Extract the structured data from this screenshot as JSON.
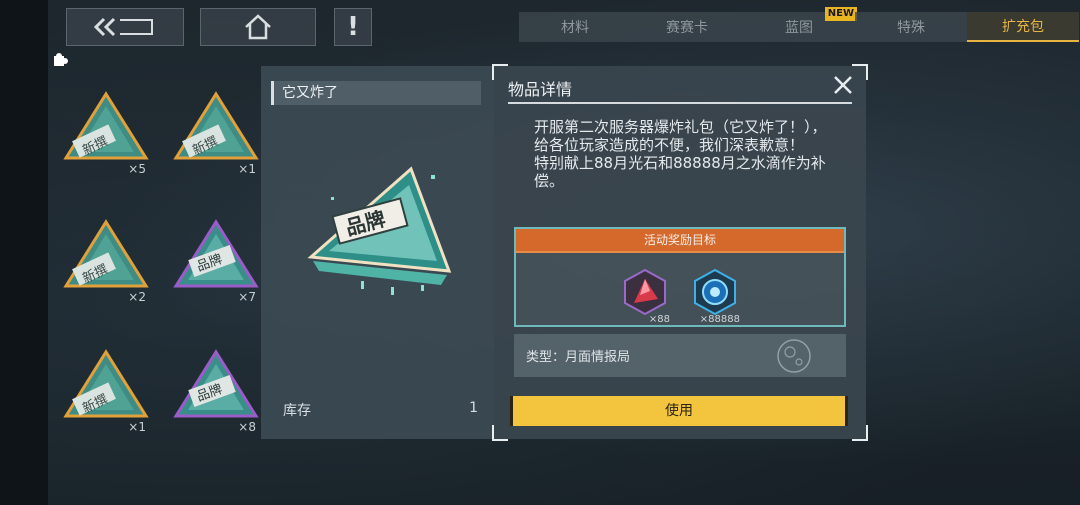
{
  "topbar": {
    "back_label": "back",
    "home_label": "home",
    "alert_label": "!"
  },
  "tabs": [
    {
      "label": "材料"
    },
    {
      "label": "赛赛卡"
    },
    {
      "label": "蓝图",
      "badge": "NEW"
    },
    {
      "label": "特殊"
    },
    {
      "label": "扩充包",
      "active": true
    }
  ],
  "inventory": [
    {
      "type": "new-pack",
      "label": "新撰",
      "count": "×5"
    },
    {
      "type": "new-pack",
      "label": "新撰",
      "count": "×1"
    },
    {
      "type": "new-pack",
      "label": "新撰",
      "count": "×2"
    },
    {
      "type": "brand-pack",
      "label": "品牌",
      "count": "×7"
    },
    {
      "type": "new-pack",
      "label": "新撰",
      "count": "×1"
    },
    {
      "type": "brand-pack",
      "label": "品牌",
      "count": "×8"
    }
  ],
  "item_info": {
    "name": "它又炸了",
    "icon_label": "品牌",
    "stock_label": "库存",
    "stock_value": "1"
  },
  "detail": {
    "title": "物品详情",
    "description": "开服第二次服务器爆炸礼包（它又炸了！），给各位玩家造成的不便，我们深表歉意！\n特别献上88月光石和88888月之水滴作为补偿。",
    "reward_header": "活动奖励目标",
    "rewards": [
      {
        "name": "moonstone-icon",
        "qty": "×88"
      },
      {
        "name": "moon-water-icon",
        "qty": "×88888"
      }
    ],
    "type_text": "类型：月面情报局",
    "use_label": "使用"
  },
  "colors": {
    "accent": "#e7b441",
    "reward_header": "#d5682b",
    "reward_border": "#6fb9bd",
    "use_button": "#f3c53f",
    "new_frame": "#e0a03a",
    "brand_frame": "#9a5cc8"
  }
}
